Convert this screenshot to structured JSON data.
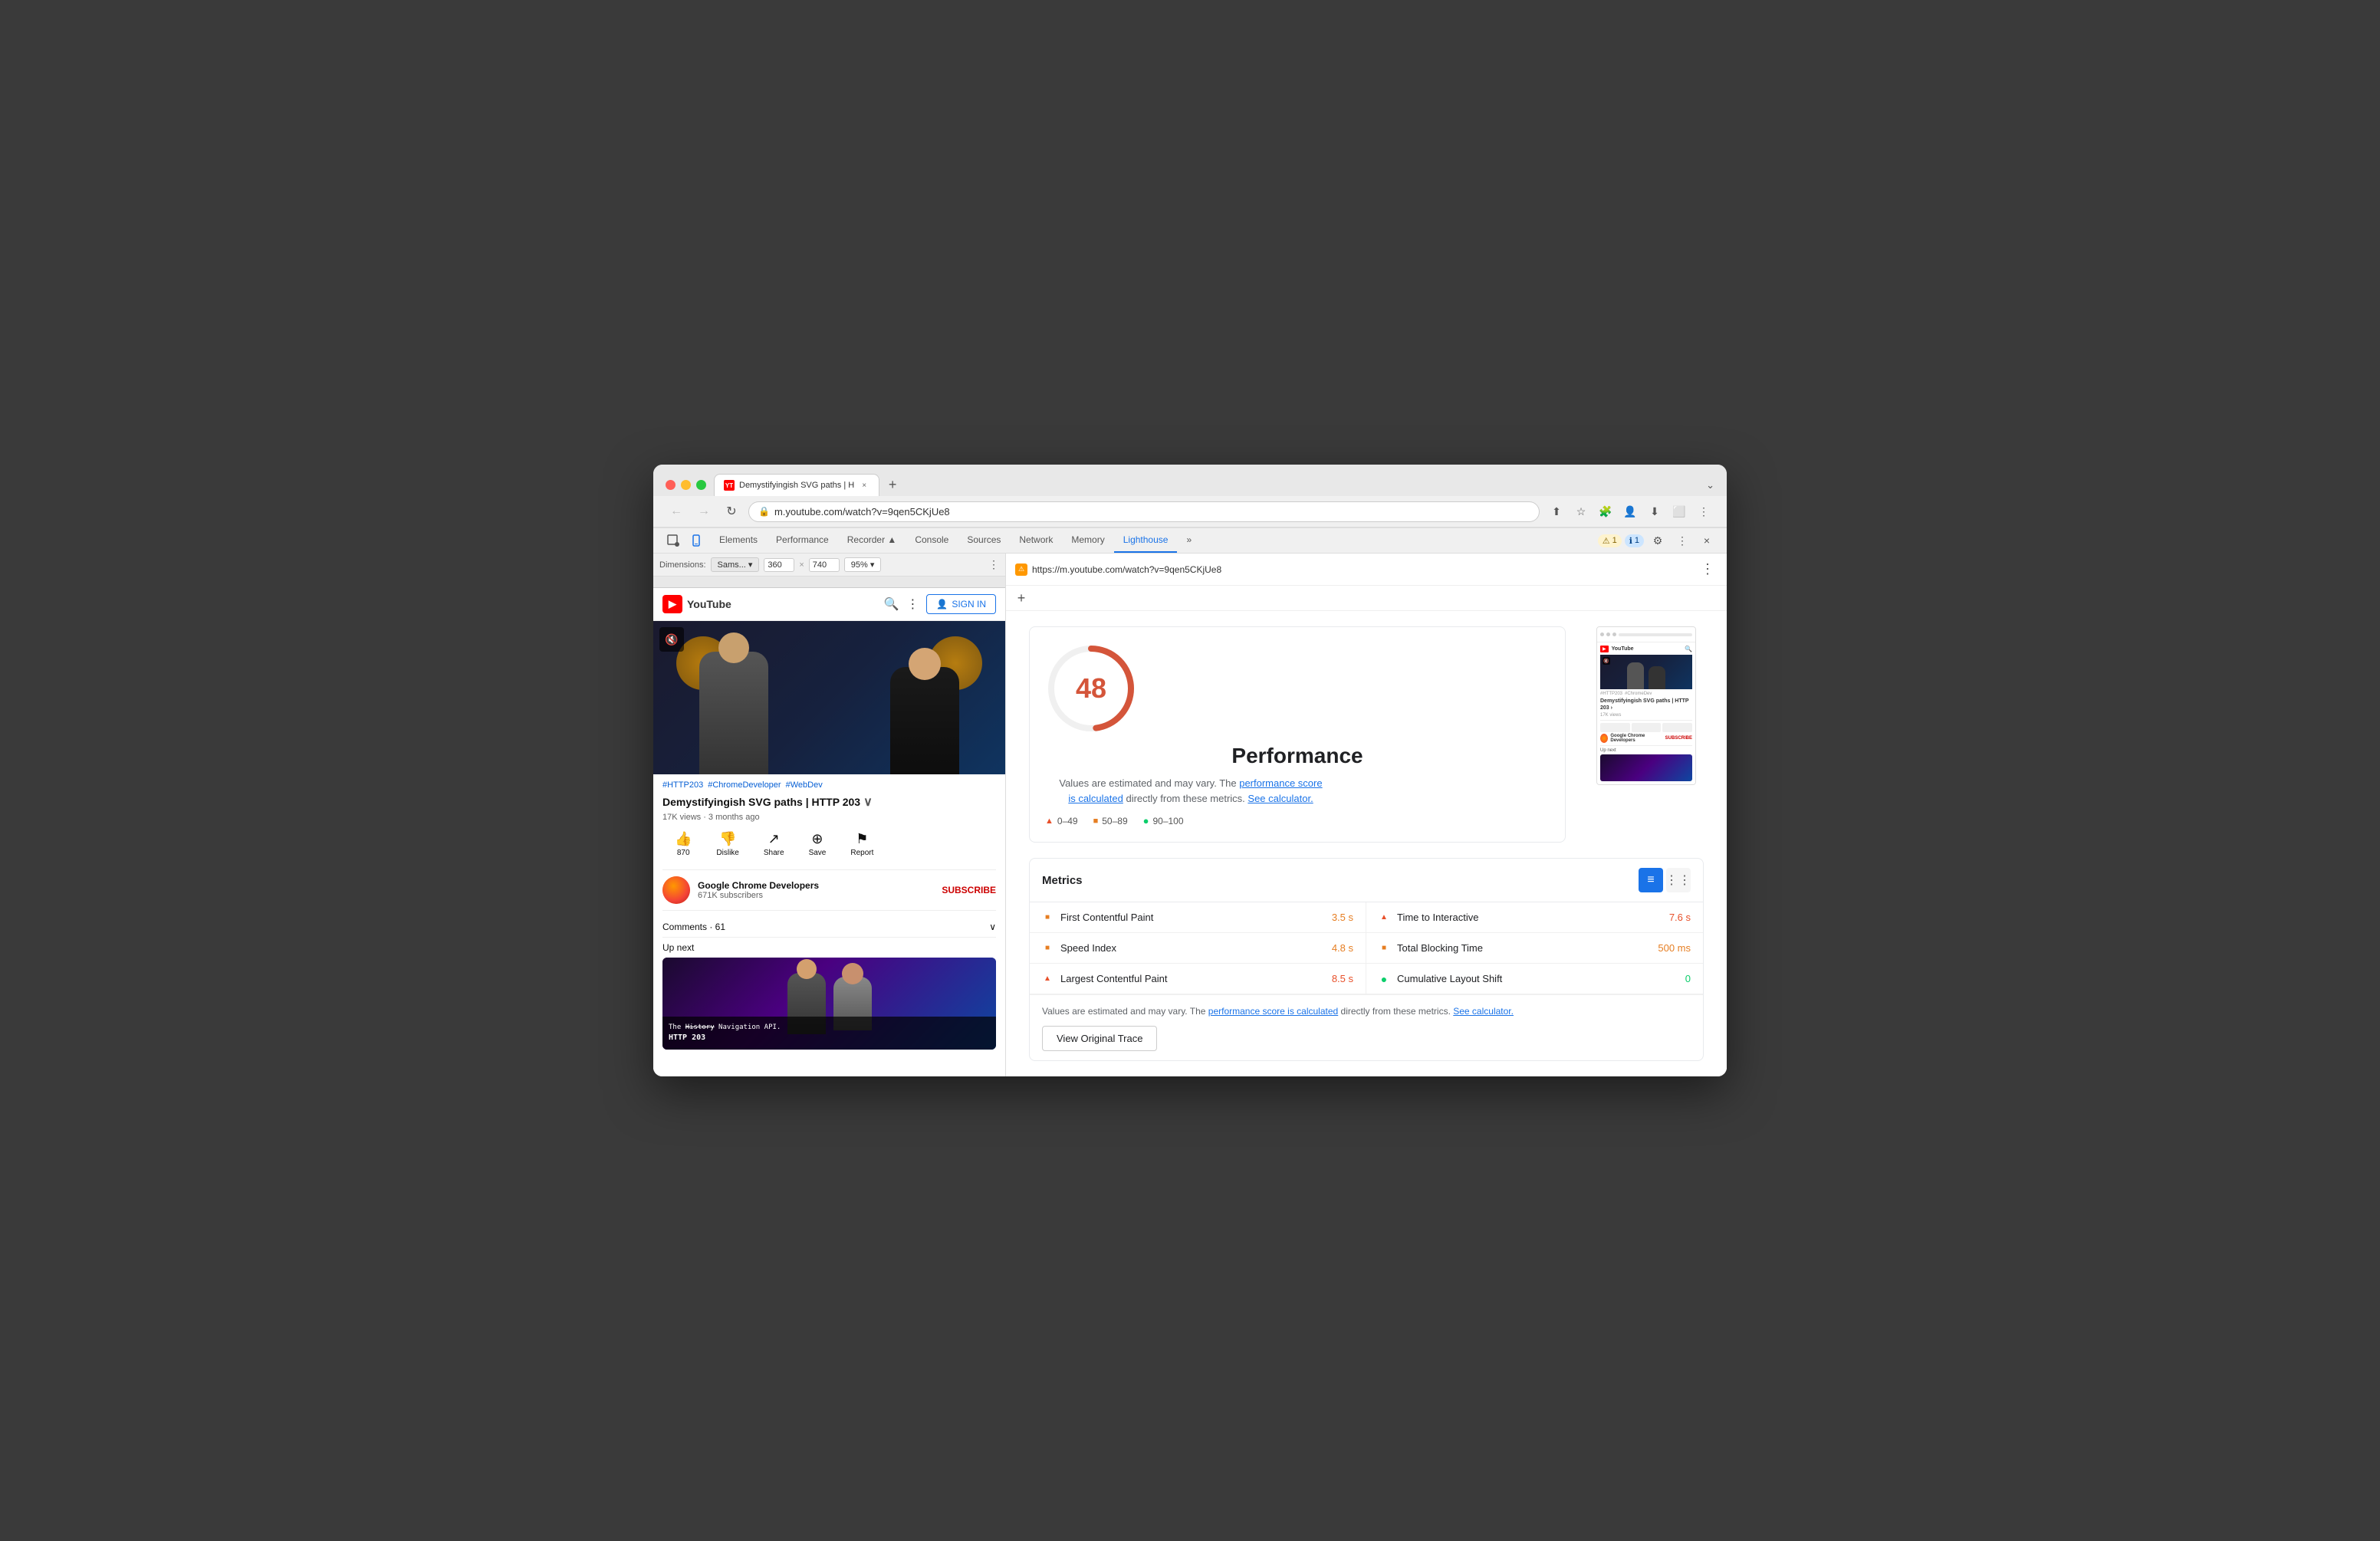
{
  "browser": {
    "tab": {
      "favicon_label": "YT",
      "title": "Demystifyingish SVG paths | H",
      "close_label": "×"
    },
    "new_tab_label": "+",
    "end_btn_label": "⌄",
    "url": "m.youtube.com/watch?v=9qen5CKjUe8",
    "url_prefix": "https://",
    "nav": {
      "back": "←",
      "forward": "→",
      "refresh": "↻",
      "home": "⌂"
    },
    "nav_actions": {
      "share": "⬆",
      "bookmark": "☆",
      "extensions": "🧩",
      "profile": "👤",
      "download": "⬇",
      "more": "⋮"
    }
  },
  "devtools": {
    "tabs": [
      {
        "label": "Elements",
        "active": false
      },
      {
        "label": "Performance",
        "active": false
      },
      {
        "label": "Recorder ▲",
        "active": false
      },
      {
        "label": "Console",
        "active": false
      },
      {
        "label": "Sources",
        "active": false
      },
      {
        "label": "Network",
        "active": false
      },
      {
        "label": "Memory",
        "active": false
      },
      {
        "label": "Lighthouse",
        "active": true
      }
    ],
    "more_tabs_label": "»",
    "warning_badge": "1",
    "info_badge": "1",
    "settings_icon": "⚙",
    "close_icon": "×",
    "more_icon": "⋮",
    "left_icons": {
      "inspect": "⬚",
      "device": "📱"
    },
    "add_panel_label": "+",
    "url": "https://m.youtube.com/watch?v=9qen5CKjUe8",
    "favicon_color": "#ff9800"
  },
  "dimensions_bar": {
    "label": "Dimensions:",
    "device": "Sams...",
    "width": "360",
    "separator": "×",
    "height": "740",
    "zoom": "95%",
    "more_icon": "⋮"
  },
  "youtube": {
    "logo_text": "YouTube",
    "logo_icon": "▶",
    "sign_in_text": "SIGN IN",
    "sign_in_icon": "👤",
    "search_icon": "🔍",
    "more_icon": "⋮",
    "mute_icon": "🔇",
    "tags": [
      "#HTTP203",
      "#ChromeDeveloper",
      "#WebDev"
    ],
    "title": "Demystifyingish SVG paths | HTTP 203",
    "chevron": "∨",
    "meta": "17K views · 3 months ago",
    "actions": [
      {
        "icon": "👍",
        "label": "870"
      },
      {
        "icon": "👎",
        "label": "Dislike"
      },
      {
        "icon": "↗",
        "label": "Share"
      },
      {
        "icon": "⊕",
        "label": "Save"
      },
      {
        "icon": "⚑",
        "label": "Report"
      }
    ],
    "channel_name": "Google Chrome Developers",
    "channel_subs": "671K subscribers",
    "subscribe_label": "SUBSCRIBE",
    "comments_label": "Comments · 61",
    "comments_icon": "∨",
    "upnext_label": "Up next",
    "next_video_overlay": "The History Navigation API.\nHTTP 203"
  },
  "lighthouse": {
    "score": "48",
    "score_label": "Performance",
    "score_color": "#d4553a",
    "gauge_track_color": "#eee",
    "description_start": "Values are estimated and may vary. The ",
    "description_link": "performance score\nis calculated",
    "description_end": " directly from these metrics. See calculator.",
    "see_calculator": "See calculator.",
    "legend": [
      {
        "icon": "▲",
        "color": "#e8502a",
        "label": "0–49"
      },
      {
        "icon": "■",
        "color": "#e67e22",
        "label": "50–89"
      },
      {
        "icon": "●",
        "color": "#0cce6b",
        "label": "90–100"
      }
    ],
    "metrics_title": "Metrics",
    "view_list_icon": "≡",
    "view_grid_icon": "⋮⋮",
    "metrics": [
      {
        "icon_type": "orange_square",
        "label": "First Contentful Paint",
        "value": "3.5 s",
        "value_color": "orange"
      },
      {
        "icon_type": "red_triangle",
        "label": "Time to Interactive",
        "value": "7.6 s",
        "value_color": "red"
      },
      {
        "icon_type": "orange_square",
        "label": "Speed Index",
        "value": "4.8 s",
        "value_color": "orange"
      },
      {
        "icon_type": "orange_square",
        "label": "Total Blocking Time",
        "value": "500 ms",
        "value_color": "orange"
      },
      {
        "icon_type": "red_triangle",
        "label": "Largest Contentful Paint",
        "value": "8.5 s",
        "value_color": "red"
      },
      {
        "icon_type": "green_circle",
        "label": "Cumulative Layout Shift",
        "value": "0",
        "value_color": "green"
      }
    ],
    "footer_text_start": "Values are estimated and may vary. The ",
    "footer_link": "performance score is calculated",
    "footer_text_end": " directly from these metrics. ",
    "footer_calc_link": "See calculator.",
    "view_trace_label": "View Original Trace",
    "more_icon": "⋮"
  },
  "screenshot": {
    "yt_title": "Demystifyingish SVG paths | HTTP 203 ›",
    "views_label": "17K views",
    "channel_small": "Google Chrome Developers"
  }
}
